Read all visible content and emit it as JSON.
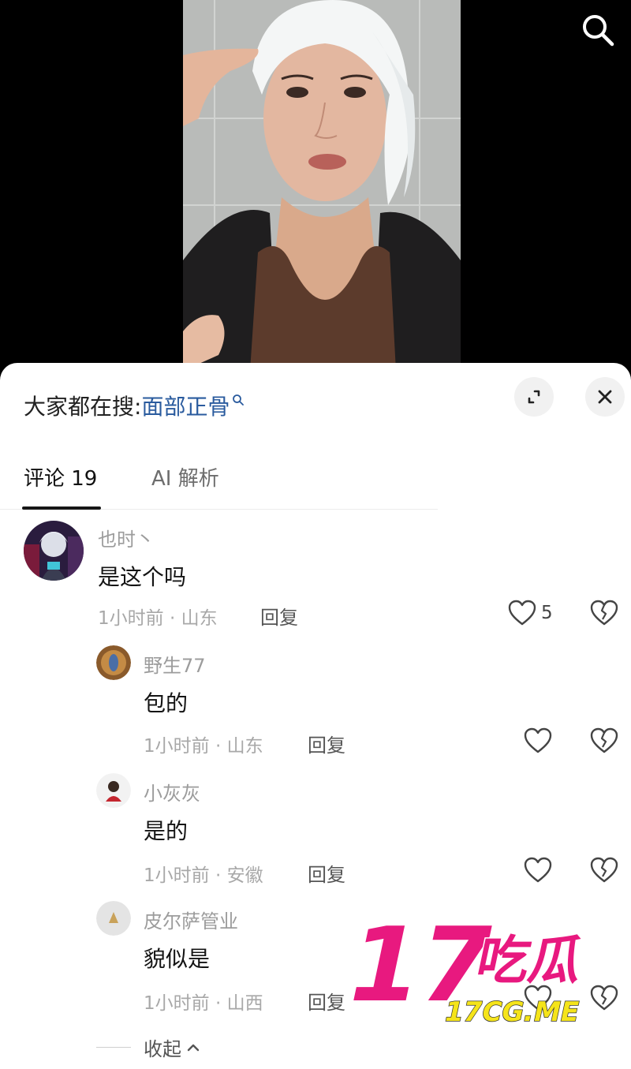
{
  "hot_search": {
    "prefix": "大家都在搜:",
    "keyword": "面部正骨"
  },
  "tabs": [
    {
      "label": "评论 19"
    },
    {
      "label": "AI 解析"
    }
  ],
  "comments": [
    {
      "name": "也时丶",
      "text": "是这个吗",
      "meta": "1小时前 · 山东",
      "reply": "回复",
      "likes": "5"
    },
    {
      "name": "野生77",
      "text": "包的",
      "meta": "1小时前 · 山东",
      "reply": "回复",
      "likes": ""
    },
    {
      "name": "小灰灰",
      "text": "是的",
      "meta": "1小时前 · 安徽",
      "reply": "回复",
      "likes": ""
    },
    {
      "name": "皮尔萨管业",
      "text": "貌似是",
      "meta": "1小时前 · 山西",
      "reply": "回复",
      "likes": ""
    }
  ],
  "collapse_label": "收起",
  "watermark": {
    "big": "17吃瓜",
    "small": "17CG.ME"
  },
  "colors": {
    "link": "#2a5b9e",
    "watermark_pink": "#e8197f",
    "watermark_yellow": "#f5e41a"
  }
}
